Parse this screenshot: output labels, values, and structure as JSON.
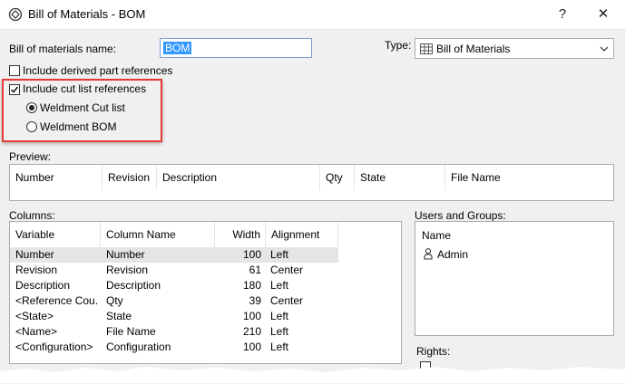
{
  "window": {
    "title": "Bill of Materials - BOM",
    "help_label": "?",
    "close_label": "✕"
  },
  "form": {
    "name_label": "Bill of materials name:",
    "name_value": "BOM",
    "type_label": "Type:",
    "type_value": "Bill of Materials",
    "derived_label": "Include derived part references",
    "derived_checked": false,
    "cutlist_label": "Include cut list references",
    "cutlist_checked": true,
    "radio_weldment_cut": "Weldment Cut list",
    "radio_weldment_bom": "Weldment BOM",
    "selected_radio": "Weldment Cut list"
  },
  "preview": {
    "label": "Preview:",
    "headers": [
      "Number",
      "Revision",
      "Description",
      "Qty",
      "State",
      "File Name"
    ]
  },
  "columns": {
    "label": "Columns:",
    "headers": [
      "Variable",
      "Column Name",
      "Width",
      "Alignment"
    ],
    "rows": [
      {
        "variable": "Number",
        "column_name": "Number",
        "width": "100",
        "alignment": "Left"
      },
      {
        "variable": "Revision",
        "column_name": "Revision",
        "width": "61",
        "alignment": "Center"
      },
      {
        "variable": "Description",
        "column_name": "Description",
        "width": "180",
        "alignment": "Left"
      },
      {
        "variable": "<Reference Cou...",
        "column_name": "Qty",
        "width": "39",
        "alignment": "Center"
      },
      {
        "variable": "<State>",
        "column_name": "State",
        "width": "100",
        "alignment": "Left"
      },
      {
        "variable": "<Name>",
        "column_name": "File Name",
        "width": "210",
        "alignment": "Left"
      },
      {
        "variable": "<Configuration>",
        "column_name": "Configuration",
        "width": "100",
        "alignment": "Left"
      }
    ]
  },
  "users": {
    "label": "Users and Groups:",
    "header": "Name",
    "items": [
      "Admin"
    ]
  },
  "rights": {
    "label": "Rights:"
  },
  "colors": {
    "highlight": "#e53935",
    "selection": "#3399ff"
  }
}
